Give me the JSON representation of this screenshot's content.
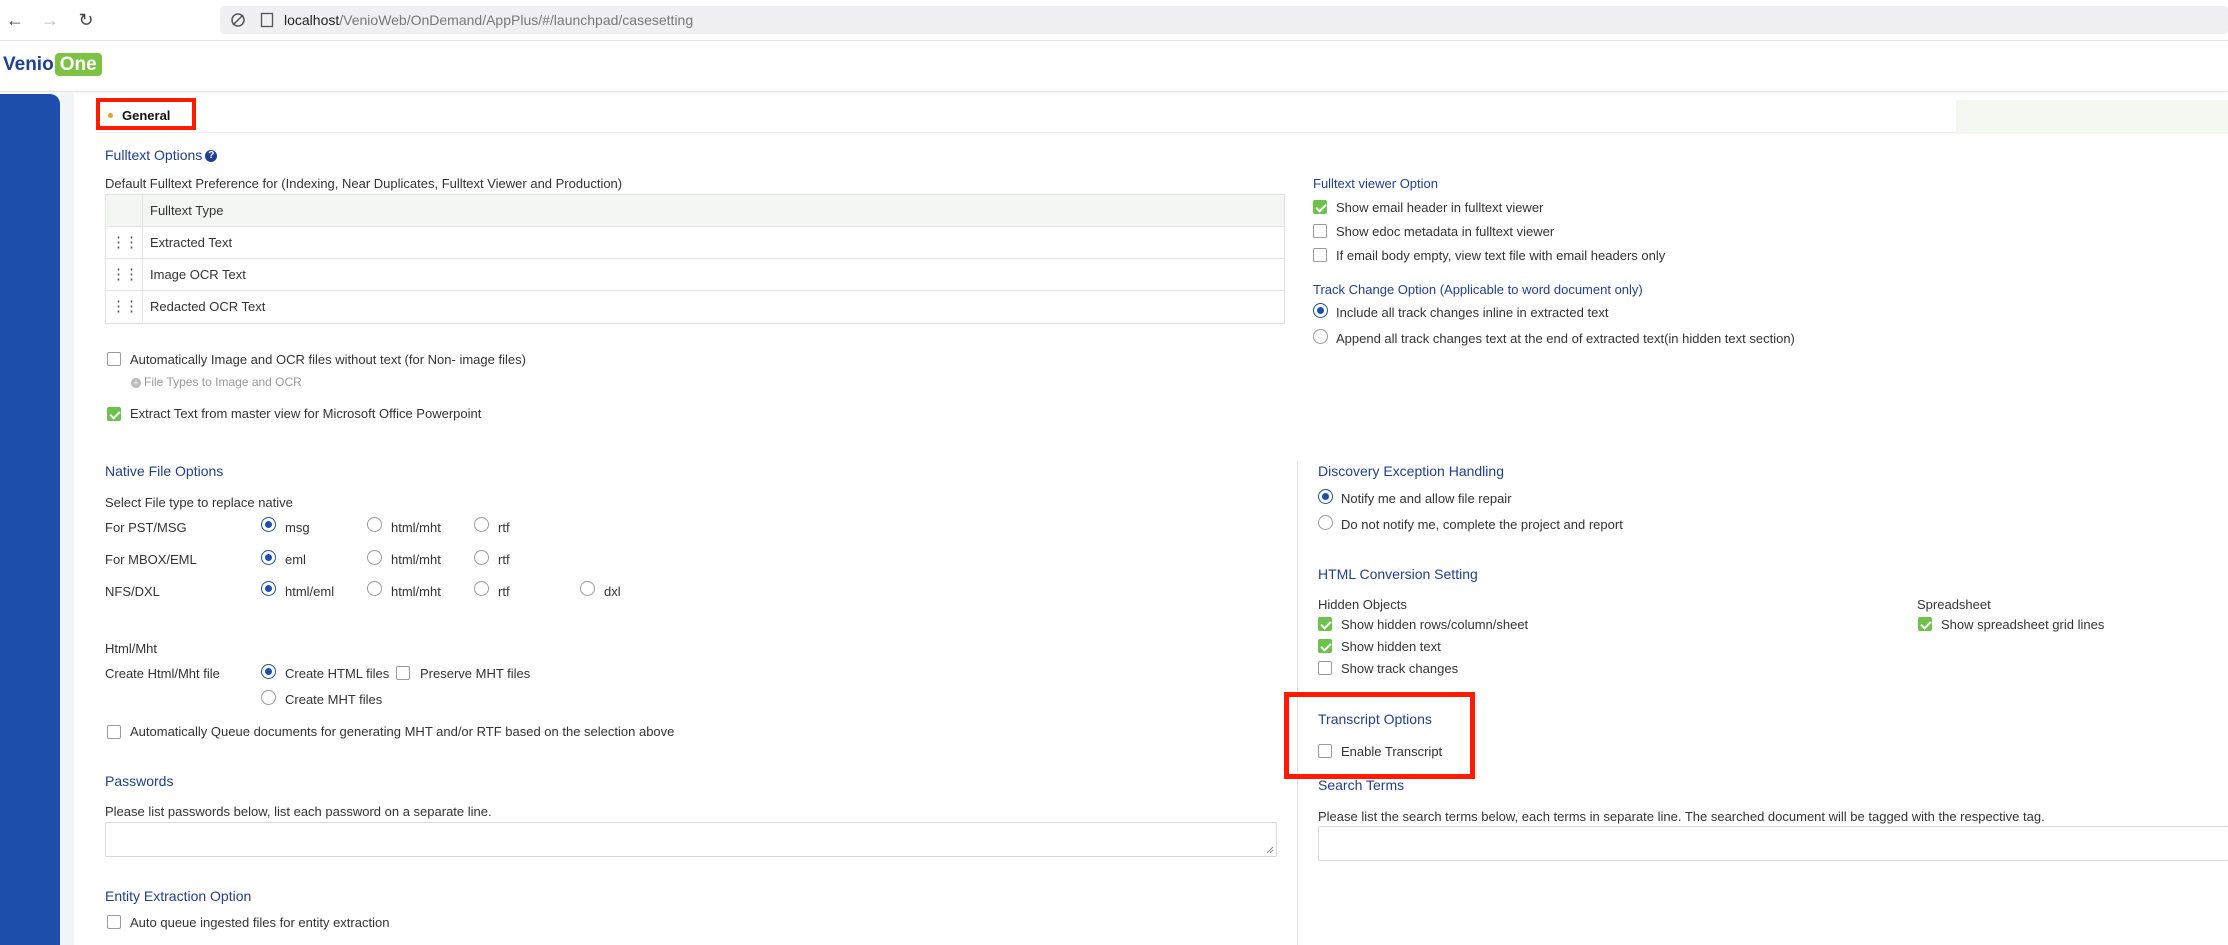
{
  "browser": {
    "url_host": "localhost",
    "url_path": "/VenioWeb/OnDemand/AppPlus/#/launchpad/casesetting"
  },
  "app": {
    "logo_venio": "Venio",
    "logo_one": "One"
  },
  "tab": {
    "general": "General"
  },
  "fulltext": {
    "title": "Fulltext Options",
    "preference_label": "Default Fulltext Preference for (Indexing, Near Duplicates, Fulltext Viewer and Production)",
    "table_header": "Fulltext Type",
    "rows": [
      "Extracted Text",
      "Image OCR Text",
      "Redacted OCR Text"
    ],
    "auto_image_ocr": "Automatically Image and OCR files without text (for Non- image files)",
    "file_types_link": "File Types to Image and OCR",
    "extract_master": "Extract Text from master view for Microsoft Office Powerpoint"
  },
  "viewer": {
    "title": "Fulltext viewer Option",
    "opt1": "Show email header in fulltext viewer",
    "opt2": "Show edoc metadata in fulltext viewer",
    "opt3": "If email body empty, view text file with email headers only"
  },
  "track_change": {
    "title": "Track Change Option (Applicable to word document only)",
    "opt1": "Include all track changes inline in extracted text",
    "opt2": "Append all track changes text at the end of extracted text(in hidden text section)"
  },
  "native": {
    "title": "Native File Options",
    "subtitle": "Select File type to replace native",
    "rows": [
      {
        "label": "For PST/MSG",
        "opts": [
          "msg",
          "html/mht",
          "rtf"
        ]
      },
      {
        "label": "For MBOX/EML",
        "opts": [
          "eml",
          "html/mht",
          "rtf"
        ]
      },
      {
        "label": "NFS/DXL",
        "opts": [
          "html/eml",
          "html/mht",
          "rtf",
          "dxl"
        ]
      }
    ]
  },
  "htmlmht": {
    "title": "Html/Mht",
    "create_label": "Create Html/Mht file",
    "create_html": "Create HTML files",
    "preserve_mht": "Preserve MHT files",
    "create_mht": "Create MHT files",
    "auto_queue": "Automatically Queue documents for generating MHT and/or RTF based on the selection above"
  },
  "passwords": {
    "title": "Passwords",
    "instructions": "Please list passwords below, list each password on a separate line."
  },
  "entity": {
    "title": "Entity Extraction Option",
    "auto_queue": "Auto queue ingested files for entity extraction"
  },
  "discovery": {
    "title": "Discovery Exception Handling",
    "opt1": "Notify me and allow file repair",
    "opt2": "Do not notify me, complete the project and report"
  },
  "html_conversion": {
    "title": "HTML Conversion Setting",
    "hidden_objects": "Hidden Objects",
    "opt1": "Show hidden rows/column/sheet",
    "opt2": "Show hidden text",
    "opt3": "Show track changes",
    "spreadsheet": "Spreadsheet",
    "grid_lines": "Show spreadsheet grid lines"
  },
  "transcript": {
    "title": "Transcript Options",
    "enable": "Enable Transcript"
  },
  "search_terms": {
    "title": "Search Terms",
    "instructions": "Please list the search terms below, each terms in separate line. The searched document will be tagged with the respective tag."
  },
  "colors": {
    "accent": "#1e4fad",
    "check": "#6cc24a",
    "highlight": "#ff1a00"
  }
}
